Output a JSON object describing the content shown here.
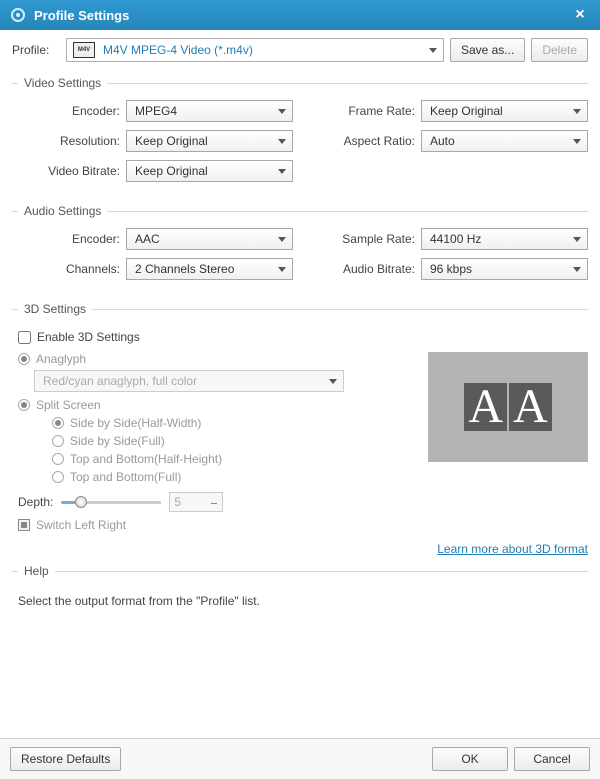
{
  "title": "Profile Settings",
  "profile": {
    "label": "Profile:",
    "value": "M4V MPEG-4 Video (*.m4v)",
    "saveAs": "Save as...",
    "delete": "Delete"
  },
  "videoSettings": {
    "title": "Video Settings",
    "encoder": {
      "label": "Encoder:",
      "value": "MPEG4"
    },
    "frameRate": {
      "label": "Frame Rate:",
      "value": "Keep Original"
    },
    "resolution": {
      "label": "Resolution:",
      "value": "Keep Original"
    },
    "aspectRatio": {
      "label": "Aspect Ratio:",
      "value": "Auto"
    },
    "videoBitrate": {
      "label": "Video Bitrate:",
      "value": "Keep Original"
    }
  },
  "audioSettings": {
    "title": "Audio Settings",
    "encoder": {
      "label": "Encoder:",
      "value": "AAC"
    },
    "sampleRate": {
      "label": "Sample Rate:",
      "value": "44100 Hz"
    },
    "channels": {
      "label": "Channels:",
      "value": "2 Channels Stereo"
    },
    "audioBitrate": {
      "label": "Audio Bitrate:",
      "value": "96 kbps"
    }
  },
  "threeD": {
    "title": "3D Settings",
    "enable": "Enable 3D Settings",
    "anaglyph": {
      "label": "Anaglyph",
      "value": "Red/cyan anaglyph, full color"
    },
    "splitScreen": {
      "label": "Split Screen",
      "sbsHalf": "Side by Side(Half-Width)",
      "sbsFull": "Side by Side(Full)",
      "tbHalf": "Top and Bottom(Half-Height)",
      "tbFull": "Top and Bottom(Full)"
    },
    "depth": {
      "label": "Depth:",
      "value": "5"
    },
    "switchLR": "Switch Left Right",
    "learnMore": "Learn more about 3D format"
  },
  "help": {
    "title": "Help",
    "text": "Select the output format from the \"Profile\" list."
  },
  "footer": {
    "restore": "Restore Defaults",
    "ok": "OK",
    "cancel": "Cancel"
  }
}
